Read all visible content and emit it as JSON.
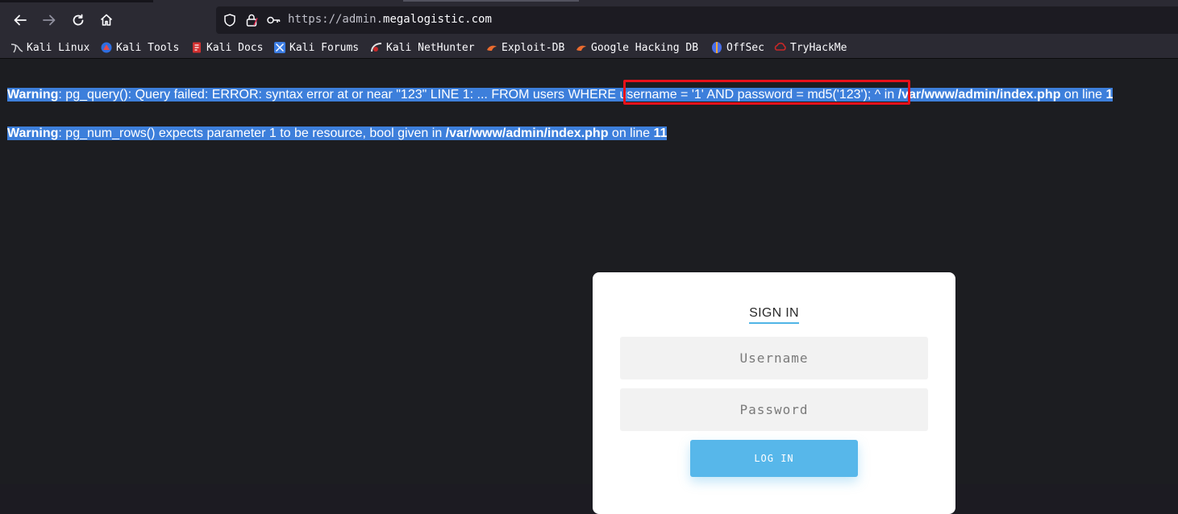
{
  "browser": {
    "url_prefix": "https://admin.",
    "url_host": "megalogistic.com",
    "bookmarks": [
      {
        "label": "Kali Linux",
        "icon": "kali-dragon-icon"
      },
      {
        "label": "Kali Tools",
        "icon": "kali-tools-icon"
      },
      {
        "label": "Kali Docs",
        "icon": "kali-docs-icon"
      },
      {
        "label": "Kali Forums",
        "icon": "kali-forums-icon"
      },
      {
        "label": "Kali NetHunter",
        "icon": "nethunter-icon"
      },
      {
        "label": "Exploit-DB",
        "icon": "exploit-db-icon"
      },
      {
        "label": "Google Hacking DB",
        "icon": "ghdb-icon"
      },
      {
        "label": "OffSec",
        "icon": "offsec-icon"
      },
      {
        "label": "TryHackMe",
        "icon": "tryhackme-icon"
      }
    ]
  },
  "warnings": [
    {
      "label": "Warning",
      "text_a": ": pg_query(): Query failed: ERROR: syntax error at or near \"123\" LINE 1: ... FROM users WHERE username = '1' AND password = md5('123'); ^ in ",
      "path": "/var/www/admin/index.php",
      "text_b": " on line ",
      "line": "1"
    },
    {
      "label": "Warning",
      "text_a": ": pg_num_rows() expects parameter 1 to be resource, bool given in ",
      "path": "/var/www/admin/index.php",
      "text_b": " on line ",
      "line": "11"
    }
  ],
  "login": {
    "title": "SIGN IN",
    "username_placeholder": "Username",
    "password_placeholder": "Password",
    "button": "LOG IN"
  },
  "colors": {
    "selection": "#3d7fdb",
    "highlight_box": "#e8111a",
    "accent": "#57b7ea"
  }
}
